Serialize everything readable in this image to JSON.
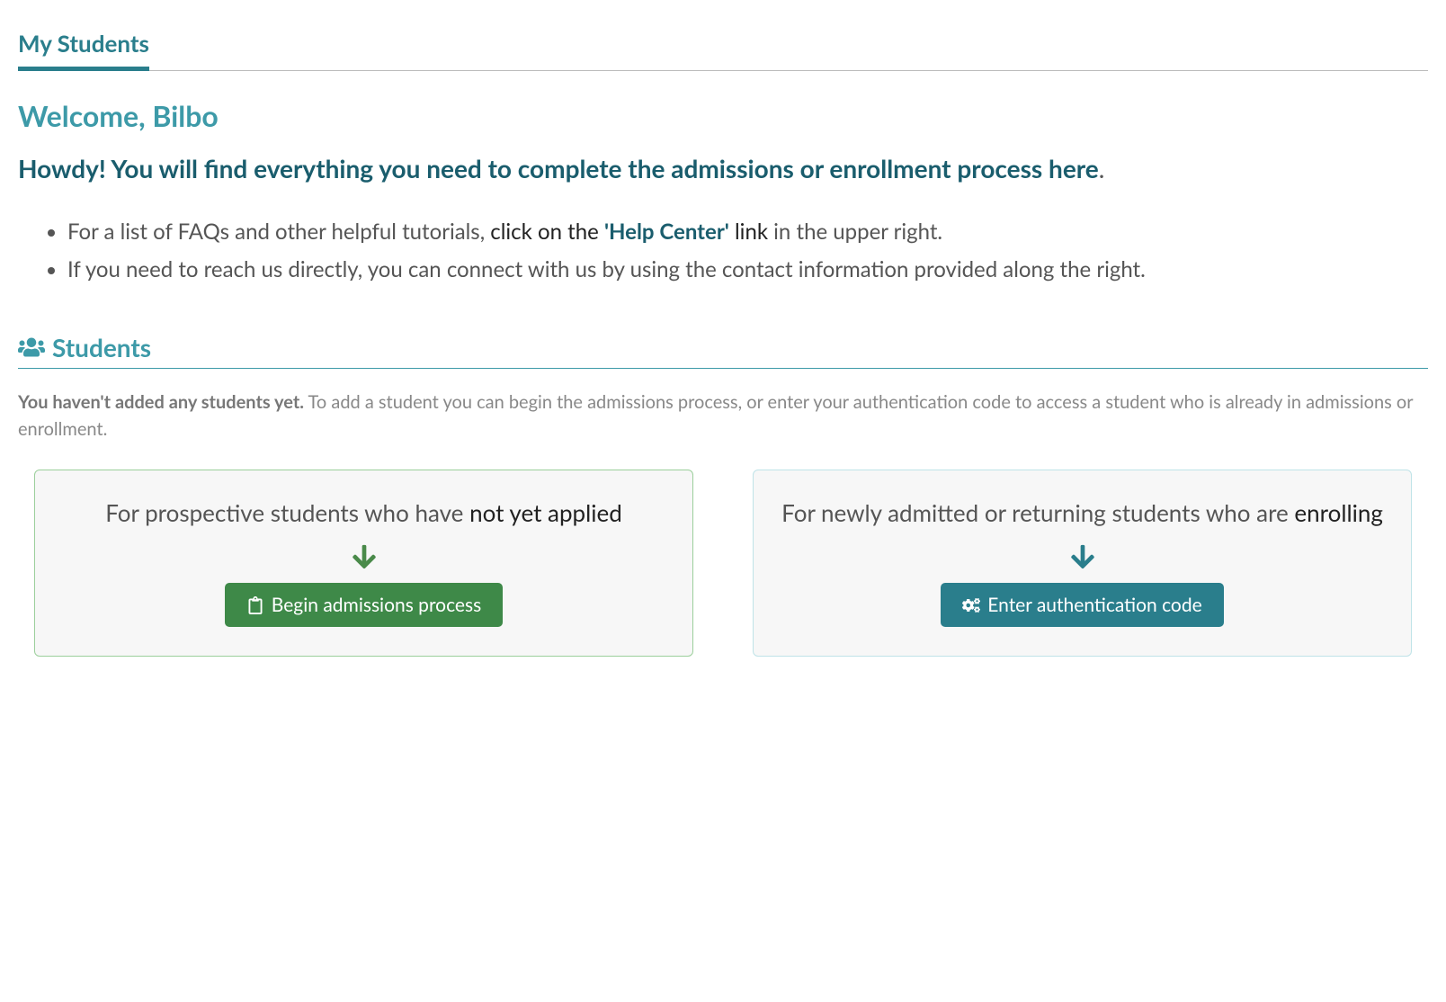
{
  "tab": {
    "title": "My Students"
  },
  "welcome": {
    "heading": "Welcome, Bilbo",
    "intro_bold": "Howdy! You will find everything you need to complete the admissions or enrollment process here",
    "intro_period": ".",
    "bullets": {
      "b1_pre": "For a list of FAQs and other helpful tutorials, ",
      "b1_dark_pre": "click on the ",
      "b1_help_center": "'Help Center'",
      "b1_dark_post": " link",
      "b1_post": " in the upper right.",
      "b2": "If you need to reach us directly, you can connect with us by using the contact information provided along the right."
    }
  },
  "students": {
    "section_title": "Students",
    "empty_strong": "You haven't added any students yet.",
    "empty_rest": " To add a student you can begin the admissions process, or enter your authentication code to access a student who is already in admissions or enrollment."
  },
  "cards": {
    "admissions": {
      "text_pre": "For prospective students who have ",
      "text_bold": "not yet applied",
      "button": "Begin admissions process"
    },
    "auth": {
      "text_pre": "For newly admitted or returning students who are ",
      "text_bold": "enrolling",
      "button": "Enter authentication code"
    }
  }
}
